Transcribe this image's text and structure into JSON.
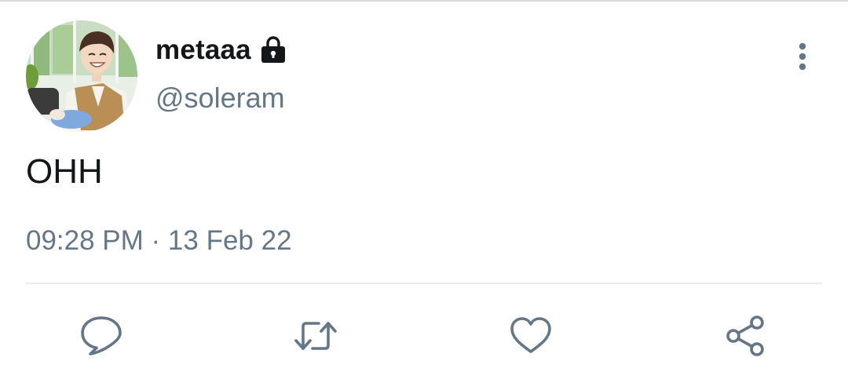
{
  "tweet": {
    "display_name": "metaaa",
    "handle": "@soleram",
    "text": "OHH",
    "timestamp": "09:28 PM · 13 Feb 22",
    "protected_icon": "lock-icon",
    "avatar_icon": "avatar-photo"
  },
  "actions": {
    "reply_icon": "reply-icon",
    "retweet_icon": "retweet-icon",
    "like_icon": "heart-icon",
    "share_icon": "share-icon",
    "more_icon": "more-vertical-icon"
  },
  "colors": {
    "primary_text": "#14171a",
    "secondary_text": "#657786",
    "divider": "#e6ecf0",
    "icon": "#657786"
  }
}
